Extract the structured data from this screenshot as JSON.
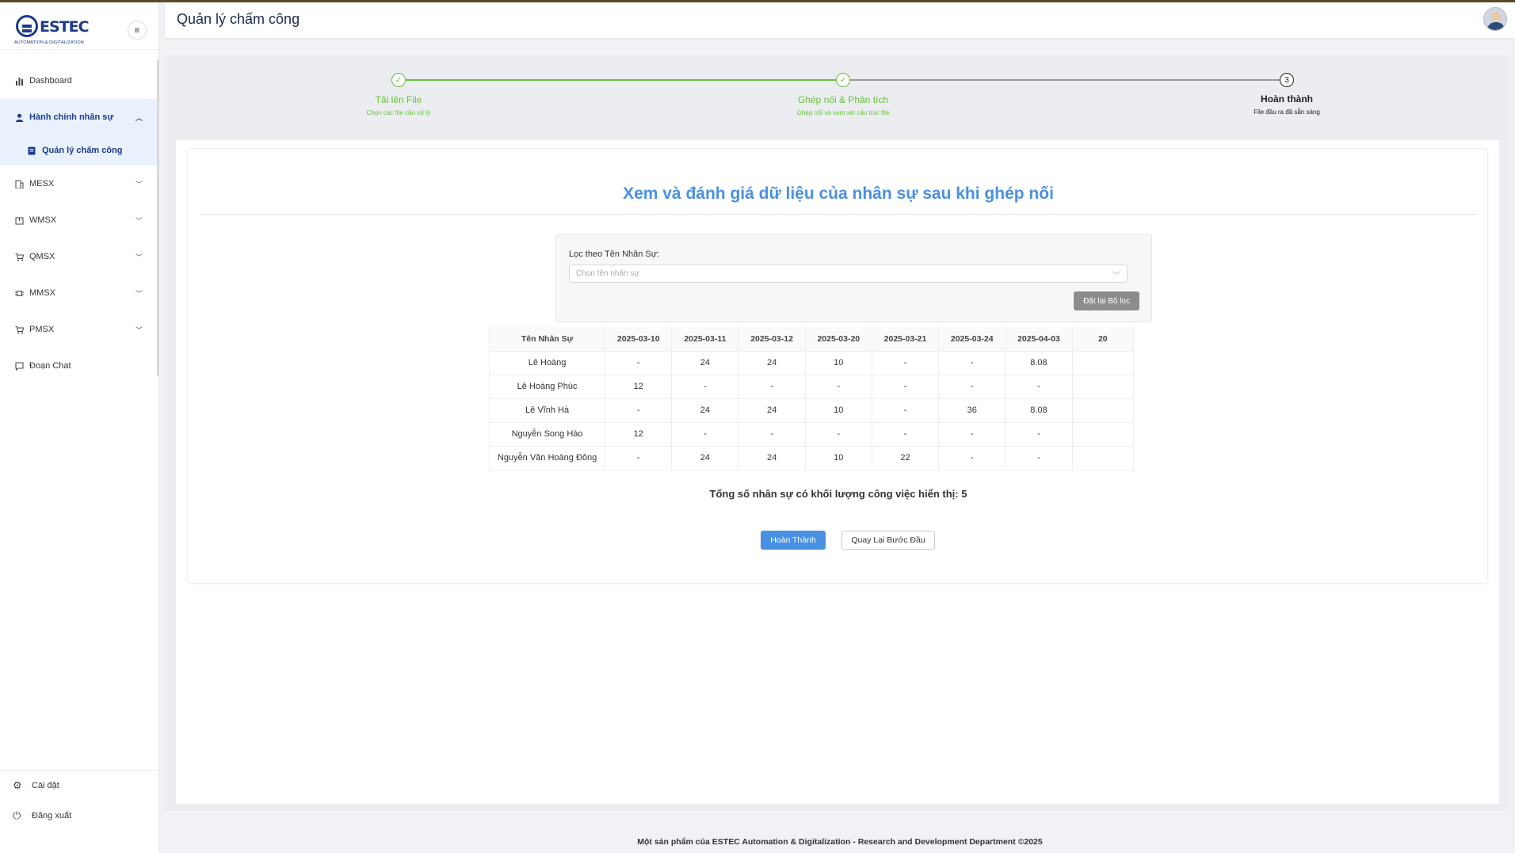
{
  "brand": {
    "name": "ESTEC",
    "tagline": "AUTOMATION & DIGITALIZATION"
  },
  "header": {
    "title": "Quản lý chấm công"
  },
  "sidebar": {
    "items": [
      {
        "label": "Dashboard",
        "icon": "bar-chart-icon"
      },
      {
        "label": "Hành chính nhân sự",
        "icon": "user-icon",
        "expanded": true
      },
      {
        "label": "Quản lý chấm công",
        "icon": "document-icon",
        "active": true
      },
      {
        "label": "MESX",
        "icon": "building-icon"
      },
      {
        "label": "WMSX",
        "icon": "package-icon"
      },
      {
        "label": "QMSX",
        "icon": "cart-icon"
      },
      {
        "label": "MMSX",
        "icon": "chip-icon"
      },
      {
        "label": "PMSX",
        "icon": "cart-icon"
      },
      {
        "label": "Đoạn Chat",
        "icon": "chat-icon"
      }
    ],
    "bottom": [
      {
        "label": "Cài đặt",
        "icon": "gear-icon"
      },
      {
        "label": "Đăng xuất",
        "icon": "power-icon"
      }
    ]
  },
  "steps": [
    {
      "title": "Tải lên File",
      "desc": "Chọn các file cần xử lý",
      "status": "done"
    },
    {
      "title": "Ghép nối & Phân tích",
      "desc": "Ghép nối và xem xét cấu trúc file",
      "status": "done"
    },
    {
      "title": "Hoàn thành",
      "desc": "File đầu ra đã sẵn sàng",
      "status": "current",
      "number": "3"
    }
  ],
  "main": {
    "heading": "Xem và đánh giá dữ liệu của nhân sự sau khi ghép nối",
    "filter": {
      "label": "Lọc theo Tên Nhân Sự:",
      "placeholder": "Chọn tên nhân sự",
      "reset_label": "Đặt lại Bộ lọc"
    },
    "table": {
      "headers": [
        "Tên Nhân Sự",
        "2025-03-10",
        "2025-03-11",
        "2025-03-12",
        "2025-03-20",
        "2025-03-21",
        "2025-03-24",
        "2025-04-03",
        "20"
      ],
      "rows": [
        [
          "Lê Hoàng",
          "-",
          "24",
          "24",
          "10",
          "-",
          "-",
          "8.08",
          ""
        ],
        [
          "Lê Hoàng Phúc",
          "12",
          "-",
          "-",
          "-",
          "-",
          "-",
          "-",
          ""
        ],
        [
          "Lê Vĩnh Hà",
          "-",
          "24",
          "24",
          "10",
          "-",
          "36",
          "8.08",
          ""
        ],
        [
          "Nguyễn Song Hào",
          "12",
          "-",
          "-",
          "-",
          "-",
          "-",
          "-",
          ""
        ],
        [
          "Nguyễn Văn Hoàng Đông",
          "-",
          "24",
          "24",
          "10",
          "22",
          "-",
          "-",
          ""
        ]
      ]
    },
    "total_label": "Tổng số nhân sự có khối lượng công việc hiển thị:",
    "total_value": "5",
    "finish_label": "Hoàn Thành",
    "back_label": "Quay Lại Bước Đầu"
  },
  "footer": {
    "text": "Một sản phẩm của ESTEC Automation & Digitalization - Research and Development Department ©2025"
  },
  "colors": {
    "accent": "#4a90e2",
    "success": "#6abf3d",
    "brand": "#1d3a8a"
  }
}
